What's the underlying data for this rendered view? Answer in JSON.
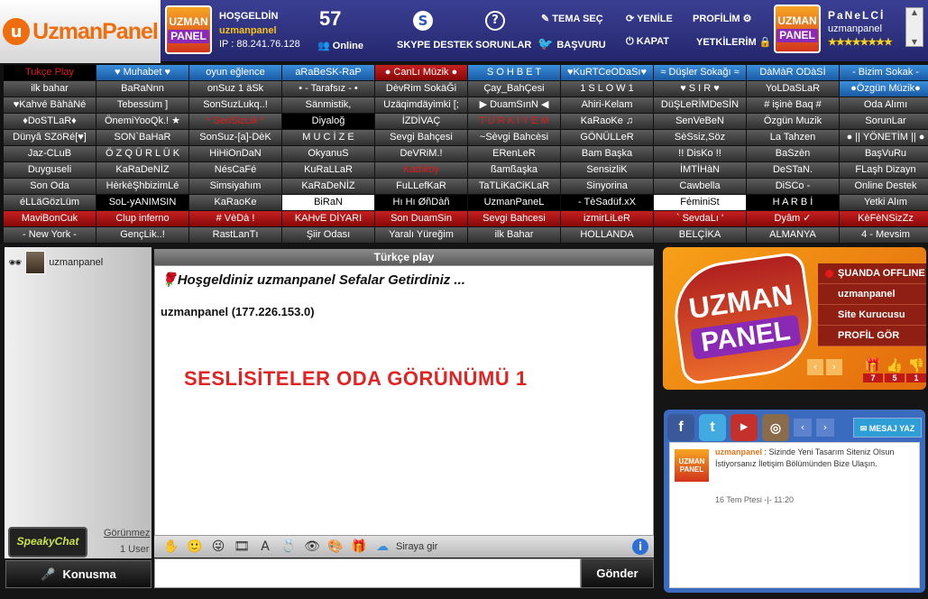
{
  "header": {
    "logo": "UzmanPanel",
    "badge_top": "UZMAN",
    "badge_bottom": "PANEL",
    "greeting": "HOŞGELDİN",
    "username": "uzmanpanel",
    "ip": "IP : 88.241.76.128",
    "online_count": "57",
    "online_label": "Online",
    "skype": "SKYPE DESTEK",
    "sorunlar": "SORUNLAR",
    "tema": "TEMA SEÇ",
    "basvuru": "BAŞVURU",
    "yenile": "YENİLE",
    "kapat": "KAPAT",
    "profilim": "PROFİLİM",
    "yetkilerim": "YETKİLERİM",
    "panel_title": "PaNeLCİ",
    "panel_user": "uzmanpanel",
    "stars": "★★★★★★★★"
  },
  "rooms": [
    {
      "label": "Tukçe Play",
      "style": "black redtext"
    },
    {
      "label": "♥ Muhabet ♥",
      "style": "blue"
    },
    {
      "label": "oyun eğlence",
      "style": "blue"
    },
    {
      "label": "aRaBeSK-RaP",
      "style": "blue"
    },
    {
      "label": "● CanLı Müzik ●",
      "style": "red"
    },
    {
      "label": "S O H B E T",
      "style": "blue"
    },
    {
      "label": "♥KuRTCeODaSı♥",
      "style": "blue"
    },
    {
      "label": "≈ Düşler Sokağı ≈",
      "style": "blue"
    },
    {
      "label": "DàMàR ODàSİ",
      "style": "blue"
    },
    {
      "label": "- Bizim Sokak -",
      "style": "blue"
    },
    {
      "label": "ilk bahar",
      "style": ""
    },
    {
      "label": "BaRaNnn",
      "style": ""
    },
    {
      "label": "onSuz 1 äSk",
      "style": ""
    },
    {
      "label": "• - Tarafsız - •",
      "style": ""
    },
    {
      "label": "DèvRim SokäĞi",
      "style": ""
    },
    {
      "label": "Çay_BahÇesi",
      "style": ""
    },
    {
      "label": "1 S L O W 1",
      "style": ""
    },
    {
      "label": "♥ S I R ♥",
      "style": ""
    },
    {
      "label": "YoLDaSLaR",
      "style": ""
    },
    {
      "label": "●Özgün Müzik●",
      "style": "blue"
    },
    {
      "label": "♥Kahvé BàhàNé",
      "style": ""
    },
    {
      "label": "Tebessüm ]",
      "style": ""
    },
    {
      "label": "SonSuzLukq..!",
      "style": ""
    },
    {
      "label": "Sänmistik,",
      "style": ""
    },
    {
      "label": "Uzäqimdäyimki [;",
      "style": ""
    },
    {
      "label": "▶ DuamSınN ◀",
      "style": ""
    },
    {
      "label": "Ahiri-Kelam",
      "style": ""
    },
    {
      "label": "DüŞLeRİMDeSİN",
      "style": ""
    },
    {
      "label": "# işinè Baq #",
      "style": ""
    },
    {
      "label": "Oda Alımı",
      "style": ""
    },
    {
      "label": "♦DoSTLaR♦",
      "style": ""
    },
    {
      "label": "ÖnemiYooQk.! ★",
      "style": ""
    },
    {
      "label": "* SenSizLik *",
      "style": "redtext"
    },
    {
      "label": "Diyaloğ",
      "style": "black"
    },
    {
      "label": "İZDİVAÇ",
      "style": ""
    },
    {
      "label": "T Ü R K İ Y E M",
      "style": "redtext"
    },
    {
      "label": "KaRaoKe ♫",
      "style": ""
    },
    {
      "label": "SenVeBeN",
      "style": ""
    },
    {
      "label": "Özgün Muzik",
      "style": ""
    },
    {
      "label": "SorunLar",
      "style": ""
    },
    {
      "label": "Dünyâ SZöRé[♥]",
      "style": ""
    },
    {
      "label": "SON`BaHaR",
      "style": ""
    },
    {
      "label": "SonSuz-[a]-DèK",
      "style": ""
    },
    {
      "label": "M U C İ Z E",
      "style": ""
    },
    {
      "label": "Sevgi Bahçesi",
      "style": ""
    },
    {
      "label": "~Sèvgi Bahcèsi",
      "style": ""
    },
    {
      "label": "GÖNÜLLeR",
      "style": ""
    },
    {
      "label": "SèSsiz,Söz",
      "style": ""
    },
    {
      "label": "La Tahzen",
      "style": ""
    },
    {
      "label": "● || YÖNETİM || ●",
      "style": ""
    },
    {
      "label": "Jaz-CLuB",
      "style": ""
    },
    {
      "label": "Ö Z Q Ü R L Ü K",
      "style": ""
    },
    {
      "label": "HiHiOnDaN",
      "style": ""
    },
    {
      "label": "OkyanuS",
      "style": ""
    },
    {
      "label": "DeVRiM.!",
      "style": ""
    },
    {
      "label": "ERenLeR",
      "style": ""
    },
    {
      "label": "Bam Başka",
      "style": ""
    },
    {
      "label": "!! DisKo !!",
      "style": ""
    },
    {
      "label": "BaSzèn",
      "style": ""
    },
    {
      "label": "BaşVuRu",
      "style": ""
    },
    {
      "label": "Duyguseli",
      "style": ""
    },
    {
      "label": "KaRaDeNİZ",
      "style": ""
    },
    {
      "label": "NésCaFé",
      "style": ""
    },
    {
      "label": "KuRaLLaR",
      "style": ""
    },
    {
      "label": "Kadıköy",
      "style": "redtext"
    },
    {
      "label": "ßamßaşka",
      "style": ""
    },
    {
      "label": "SensizliK",
      "style": ""
    },
    {
      "label": "İMTİHàN",
      "style": ""
    },
    {
      "label": "DeSTaN.",
      "style": ""
    },
    {
      "label": "FLaşh Dizayn",
      "style": ""
    },
    {
      "label": "Son Oda",
      "style": ""
    },
    {
      "label": "HèrkèŞhbizimLé",
      "style": ""
    },
    {
      "label": "Simsiyahım",
      "style": ""
    },
    {
      "label": "KaRaDeNİZ",
      "style": ""
    },
    {
      "label": "FuLLefKaR",
      "style": ""
    },
    {
      "label": "TaTLiKaCiKLaR",
      "style": ""
    },
    {
      "label": "Sinyorina",
      "style": ""
    },
    {
      "label": "Cawbella",
      "style": ""
    },
    {
      "label": "DiSCo -",
      "style": ""
    },
    {
      "label": "Online Destek",
      "style": ""
    },
    {
      "label": "éLLäGözLüm",
      "style": ""
    },
    {
      "label": "SoL-yANIMSIN",
      "style": "black"
    },
    {
      "label": "KaRaoKe",
      "style": ""
    },
    {
      "label": "BiRaN",
      "style": "white"
    },
    {
      "label": "Hı Hı ØñDàñ",
      "style": "black"
    },
    {
      "label": "UzmanPaneL",
      "style": "black"
    },
    {
      "label": "- TèSadüf.xX",
      "style": "black"
    },
    {
      "label": "FéminiSt",
      "style": "white"
    },
    {
      "label": "H A R B İ",
      "style": "black"
    },
    {
      "label": "Yetki Alım",
      "style": ""
    },
    {
      "label": "MaviBonCuk",
      "style": "red"
    },
    {
      "label": "Clup inferno",
      "style": "red"
    },
    {
      "label": "# VèDà !",
      "style": "red"
    },
    {
      "label": "KAHvE DİYARI",
      "style": "red"
    },
    {
      "label": "Son DuamSin",
      "style": "red"
    },
    {
      "label": "Sevgi Bahcesi",
      "style": "red"
    },
    {
      "label": "izmirLiLeR",
      "style": "red"
    },
    {
      "label": "` SevdaLı '",
      "style": "red"
    },
    {
      "label": "Dyâm ✓",
      "style": "red"
    },
    {
      "label": "KèFèNSizZz",
      "style": "red"
    },
    {
      "label": "- New York -",
      "style": ""
    },
    {
      "label": "GençLik..!",
      "style": ""
    },
    {
      "label": "RastLanTı",
      "style": ""
    },
    {
      "label": "Şiir Odası",
      "style": ""
    },
    {
      "label": "Yaralı Yüreğim",
      "style": ""
    },
    {
      "label": "ilk Bahar",
      "style": ""
    },
    {
      "label": "HOLLANDA",
      "style": ""
    },
    {
      "label": "BELÇİKA",
      "style": ""
    },
    {
      "label": "ALMANYA",
      "style": ""
    },
    {
      "label": "4 - Mevsim",
      "style": ""
    }
  ],
  "userlist": {
    "user": "uzmanpanel",
    "speaky": "SpeakyChat",
    "gorunmez": "Görünmez",
    "count": "1 User",
    "konusma": "Konusma"
  },
  "chat": {
    "title": "Türkçe play",
    "welcome": "Hoşgeldiniz uzmanpanel Sefalar Getirdiniz ...",
    "ipline": "uzmanpanel (177.226.153.0)",
    "big_title": "SESLİSİTELER  ODA GÖRÜNÜMÜ 1",
    "siraya": "Siraya gir",
    "gonder": "Gönder"
  },
  "profile": {
    "logo_top": "UZMAN",
    "logo_bottom": "PANEL",
    "status": "ŞUANDA OFFLINE",
    "name": "uzmanpanel",
    "role": "Site Kurucusu",
    "profil_gor": "PROFİL GÖR",
    "stat1": "7",
    "stat2": "5",
    "stat3": "1"
  },
  "feed": {
    "mesaj_yaz": "MESAJ YAZ",
    "user": "uzmanpanel",
    "text": " : Sizinde Yeni Tasarım Siteniz Olsun İstiyorsanız İletişim Bölümünden Bize Ulaşın.",
    "date": "16 Tem Ptesi -|- 11:20"
  }
}
